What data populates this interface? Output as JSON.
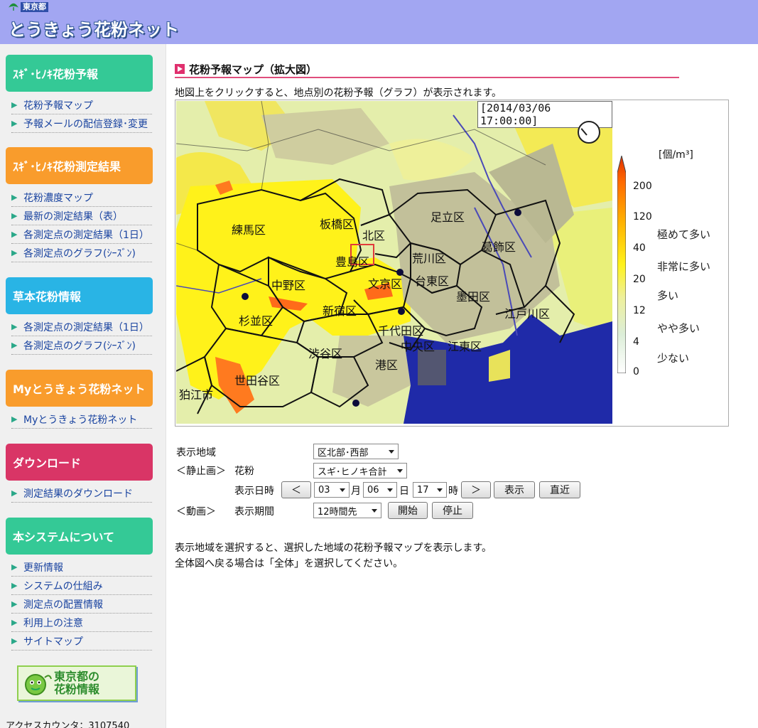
{
  "header": {
    "tokyo_label": "東京都",
    "site_title": "とうきょう花粉ネット",
    "bg_color": "#a2a6f2"
  },
  "sidebar": {
    "sections": [
      {
        "title": "ｽｷﾞ･ﾋﾉｷ花粉予報",
        "color": "#34c996",
        "links": [
          "花粉予報マップ",
          "予報メールの配信登録･変更"
        ]
      },
      {
        "title": "ｽｷﾞ･ﾋﾉｷ花粉測定結果",
        "color": "#f99c2c",
        "links": [
          "花粉濃度マップ",
          "最新の測定結果（表）",
          "各測定点の測定結果（1日）",
          "各測定点のグラフ(ｼｰｽﾞﾝ)"
        ]
      },
      {
        "title": "草本花粉情報",
        "color": "#29b4e5",
        "links": [
          "各測定点の測定結果（1日）",
          "各測定点のグラフ(ｼｰｽﾞﾝ)"
        ]
      },
      {
        "title": "Myとうきょう花粉ネット",
        "color": "#f99c2c",
        "links": [
          "Myとうきょう花粉ネット"
        ]
      },
      {
        "title": "ダウンロード",
        "color": "#d93566",
        "links": [
          "測定結果のダウンロード"
        ]
      },
      {
        "title": "本システムについて",
        "color": "#34c996",
        "links": [
          "更新情報",
          "システムの仕組み",
          "測定点の配置情報",
          "利用上の注意",
          "サイトマップ"
        ]
      }
    ],
    "banner_line1": "東京都の",
    "banner_line2": "花粉情報",
    "counter": "アクセスカウンタ：3107540"
  },
  "main": {
    "title": "花粉予報マップ（拡大図）",
    "intro": "地図上をクリックすると、地点別の花粉予報（グラフ）が表示されます。",
    "map": {
      "timestamp": "[2014/03/06 17:00:00]",
      "wards": [
        "練馬区",
        "板橋区",
        "北区",
        "足立区",
        "葛飾区",
        "豊島区",
        "荒川区",
        "中野区",
        "文京区",
        "台東区",
        "杉並区",
        "新宿区",
        "墨田区",
        "江戸川区",
        "千代田区",
        "中央区",
        "江東区",
        "渋谷区",
        "港区",
        "世田谷区",
        "狛江市"
      ],
      "legend": {
        "unit": "[個/m³]",
        "ticks": [
          "200",
          "120",
          "40",
          "20",
          "12",
          "4",
          "0"
        ],
        "levels": [
          "極めて多い",
          "非常に多い",
          "多い",
          "やや多い",
          "少ない"
        ]
      }
    },
    "form": {
      "area_label": "表示地域",
      "area_value": "区北部･西部",
      "static_label": "＜静止画＞",
      "pollen_label": "花粉",
      "pollen_value": "スギ･ヒノキ合計",
      "datetime_label": "表示日時",
      "prev_button": "＜",
      "month_value": "03",
      "month_unit": "月",
      "day_value": "06",
      "day_unit": "日",
      "hour_value": "17",
      "hour_unit": "時",
      "next_button": "＞",
      "show_button": "表示",
      "latest_button": "直近",
      "anim_label": "＜動画＞",
      "period_label": "表示期間",
      "period_value": "12時間先",
      "start_button": "開始",
      "stop_button": "停止"
    },
    "note_line1": "表示地域を選択すると、選択した地域の花粉予報マップを表示します。",
    "note_line2": "全体図へ戻る場合は「全体」を選択してください。"
  }
}
